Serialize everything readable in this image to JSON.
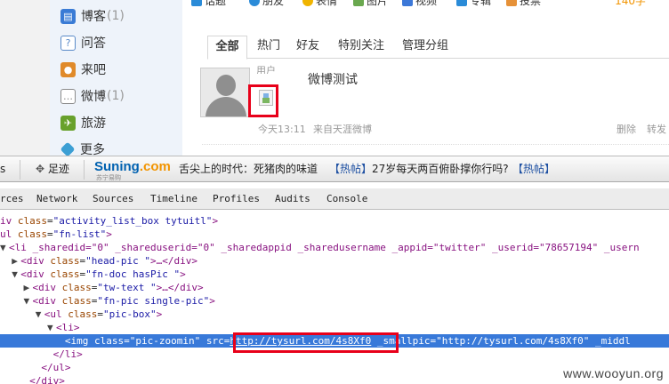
{
  "nav": {
    "items": [
      {
        "label": "博客",
        "count": "(1)",
        "icon": "blog-icon",
        "color": "#3a7bd5"
      },
      {
        "label": "问答",
        "count": "",
        "icon": "question-icon",
        "color": "#5a8ac8"
      },
      {
        "label": "来吧",
        "count": "",
        "icon": "people-icon",
        "color": "#e08a2a"
      },
      {
        "label": "微博",
        "count": "(1)",
        "icon": "microblog-icon",
        "color": "#8a8a8a"
      },
      {
        "label": "旅游",
        "count": "",
        "icon": "travel-icon",
        "color": "#68a12c"
      },
      {
        "label": "更多",
        "count": "",
        "icon": "more-icon",
        "color": "#3c9fd4"
      }
    ]
  },
  "topbar": {
    "items": [
      "话题",
      "朋友",
      "表情",
      "图片",
      "视频",
      "专辑",
      "投票"
    ],
    "count": "140字"
  },
  "tabs": [
    "全部",
    "热门",
    "好友",
    "特别关注",
    "管理分组"
  ],
  "post": {
    "username": "用户",
    "text": "微博测试",
    "time": "今天13:11",
    "source": "来自天涯微博",
    "delete_label": "删除",
    "forward_label": "转发"
  },
  "browser_bar": {
    "left_label": "s",
    "footprint_label": "足迹",
    "brand": {
      "name": "Suning",
      "suffix": ".com",
      "tagline": "苏宁易购"
    },
    "headline": "舌尖上的时代：死猪肉的味道",
    "hot_tag": "【热帖】",
    "hot_text": "27岁每天两百俯卧撑你行吗?",
    "hot_tag2": "【热帖】"
  },
  "devtools": {
    "tabs": [
      "rces",
      "Network",
      "Sources",
      "Timeline",
      "Profiles",
      "Audits",
      "Console"
    ]
  },
  "dom": {
    "l0": {
      "tag": "div",
      "attr": "class",
      "val": "\"activity_list_box tytuitl\""
    },
    "l1": {
      "tag": "ul",
      "attr": "class",
      "val": "\"fn-list\""
    },
    "l2": {
      "text": "<li _sharedid=\"0\" _shareduserid=\"0\" _sharedappid _sharedusername _appid=\"twitter\" _userid=\"78657194\" _usern"
    },
    "l3": {
      "tag": "div",
      "attr": "class",
      "val": "\"head-pic \"",
      "tail": "…</div>"
    },
    "l4": {
      "tag": "div",
      "attr": "class",
      "val": "\"fn-doc hasPic \""
    },
    "l5": {
      "tag": "div",
      "attr": "class",
      "val": "\"tw-text \"",
      "tail": "…</div>"
    },
    "l6": {
      "tag": "div",
      "attr": "class",
      "val": "\"fn-pic single-pic\""
    },
    "l7": {
      "tag": "ul",
      "attr": "class",
      "val": "\"pic-box\""
    },
    "l8": {
      "tag": "li"
    },
    "l9": {
      "tag": "img",
      "attr": "class",
      "val": "\"pic-zoomin\"",
      "src_label": "src=",
      "src": "http://tysurl.com/4s8Xf0",
      "rest": "_smallpic=\"http://tysurl.com/4s8Xf0\" _middl"
    },
    "l10": {
      "text": "</li>"
    },
    "l11": {
      "text": "</ul>"
    },
    "l12": {
      "text": "</div>"
    }
  },
  "watermark": "www.wooyun.org",
  "colors": {
    "highlight": "#e8001a",
    "selection": "#3879d9",
    "tag": "#881280",
    "attr_name": "#994500",
    "attr_value": "#1a1aa6"
  }
}
